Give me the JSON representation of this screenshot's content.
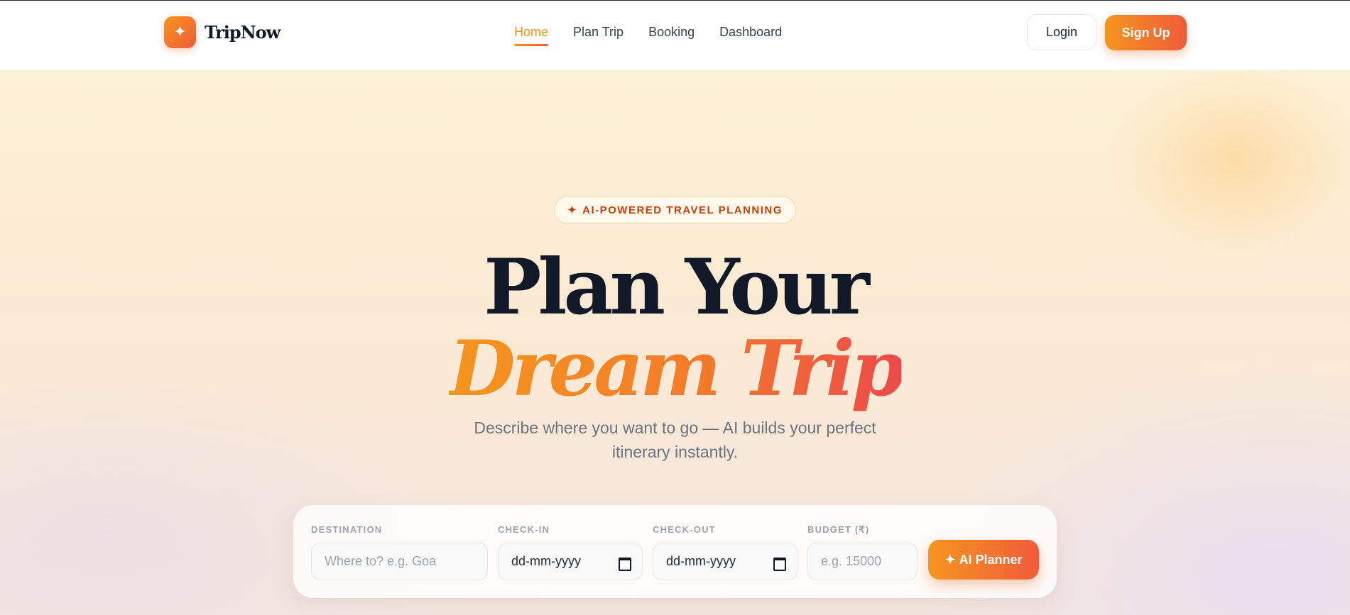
{
  "brand": {
    "name": "TripNow",
    "logo_icon": "sparkle-icon"
  },
  "nav": {
    "items": [
      {
        "label": "Home",
        "active": true
      },
      {
        "label": "Plan Trip",
        "active": false
      },
      {
        "label": "Booking",
        "active": false
      },
      {
        "label": "Dashboard",
        "active": false
      }
    ]
  },
  "auth": {
    "login_label": "Login",
    "signup_label": "Sign Up"
  },
  "hero": {
    "badge_icon": "✦",
    "badge_text": "AI-POWERED TRAVEL PLANNING",
    "title_line1": "Plan Your",
    "title_line2": "Dream Trip",
    "subtitle": "Describe where you want to go — AI builds your perfect itinerary instantly."
  },
  "search": {
    "destination": {
      "label": "DESTINATION",
      "placeholder": "Where to? e.g. Goa"
    },
    "checkin": {
      "label": "CHECK-IN",
      "value": "dd-mm-yyyy"
    },
    "checkout": {
      "label": "CHECK-OUT",
      "value": "dd-mm-yyyy"
    },
    "budget": {
      "label": "BUDGET (₹)",
      "placeholder": "e.g. 15000"
    },
    "submit_icon": "✦",
    "submit_label": "AI Planner"
  },
  "colors": {
    "accent_start": "#f6951f",
    "accent_end": "#f05b3a",
    "heading": "#111827",
    "muted": "#6b7280"
  }
}
